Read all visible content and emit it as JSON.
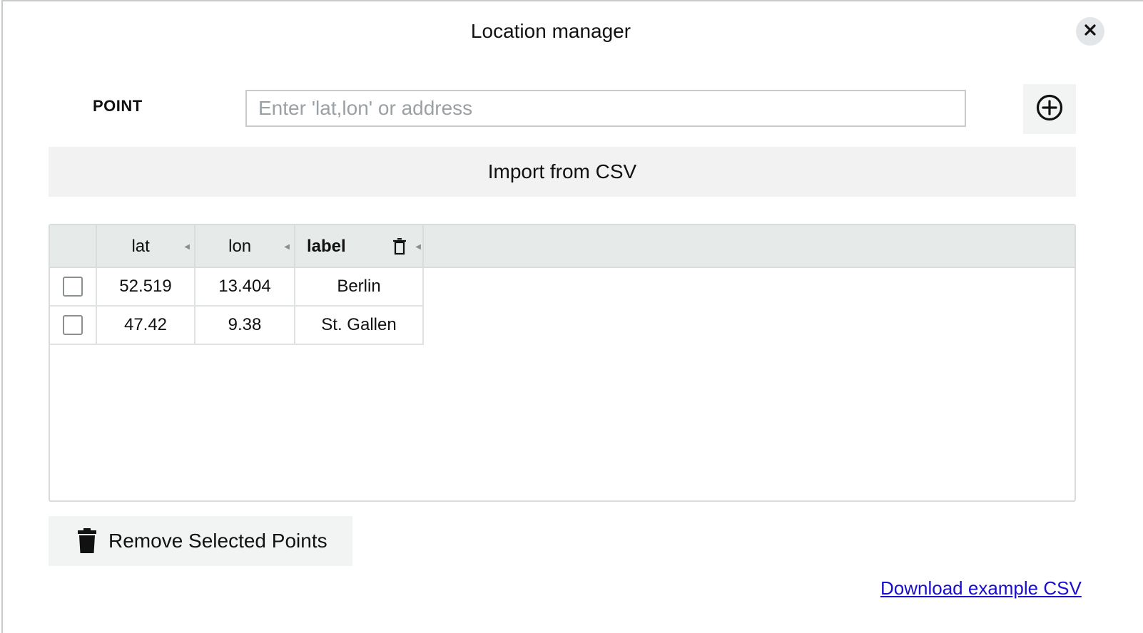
{
  "dialog": {
    "title": "Location manager"
  },
  "point": {
    "label": "POINT",
    "placeholder": "Enter 'lat,lon' or address",
    "value": ""
  },
  "import": {
    "label": "Import from CSV"
  },
  "table": {
    "columns": [
      "lat",
      "lon",
      "label"
    ],
    "rows": [
      {
        "lat": "52.519",
        "lon": "13.404",
        "label": "Berlin",
        "selected": false
      },
      {
        "lat": "47.42",
        "lon": "9.38",
        "label": "St. Gallen",
        "selected": false
      }
    ]
  },
  "actions": {
    "remove_label": "Remove Selected Points",
    "download_label": "Download example CSV"
  },
  "icons": {
    "close": "close-icon",
    "add": "plus-circle-icon",
    "column_delete": "trash-icon",
    "remove": "trash-icon"
  },
  "colors": {
    "link": "#1a0dcc",
    "header_bg": "#e6ebea",
    "button_bg": "#f2f3f3"
  }
}
